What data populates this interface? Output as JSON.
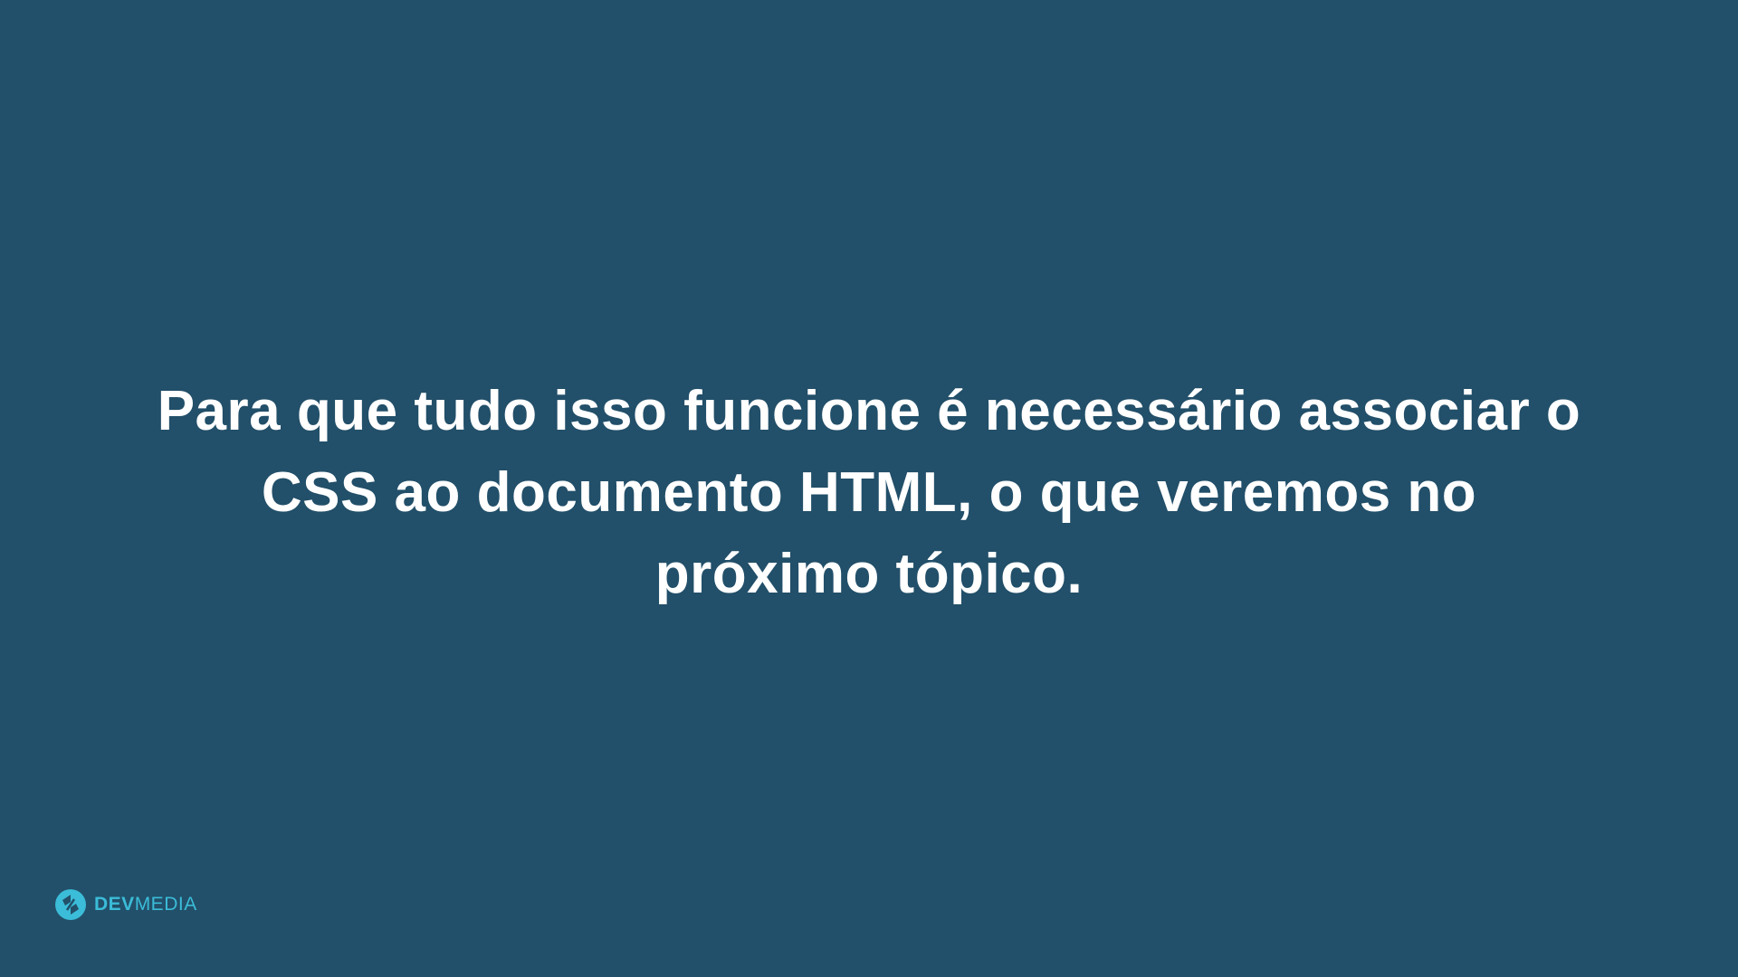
{
  "slide": {
    "message_lines": [
      "Para que tudo isso funcione é necessário associar o",
      "CSS ao documento HTML, o que veremos no",
      "próximo tópico."
    ]
  },
  "brand": {
    "name_strong": "DEV",
    "name_light": "MEDIA",
    "icon": "devmedia-logo-icon"
  },
  "colors": {
    "background": "#224f69",
    "text": "#ffffff",
    "brand_accent": "#3bbcd8"
  }
}
